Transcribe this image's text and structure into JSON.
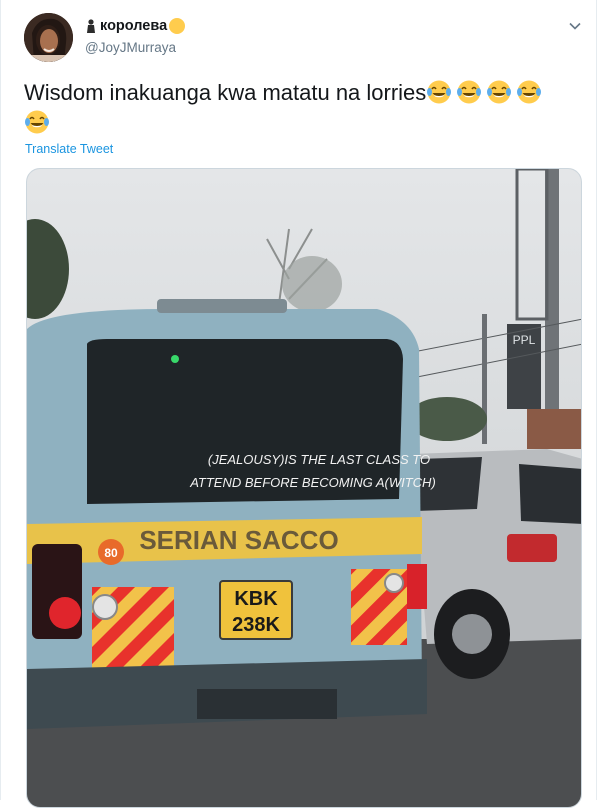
{
  "user": {
    "display_name": "королева",
    "handle": "@JoyJMurraya"
  },
  "tweet": {
    "text": "Wisdom inakuanga kwa matatu na lorries",
    "laugh_emoji_count": 5,
    "translate_label": "Translate Tweet"
  },
  "photo": {
    "van_window_line1": "(JEALOUSY)IS THE LAST  CLASS TO",
    "van_window_line2": "ATTEND BEFORE BECOMING A(WITCH)",
    "van_stripe_text": "SERIAN SACCO",
    "plate_line1": "KBK",
    "plate_line2": "238K",
    "speed_badge": "80",
    "billboard_text": "PPL"
  },
  "icons": {
    "menu": "chevron-down-icon",
    "crown": "crown-icon",
    "laugh": "face-with-tears-of-joy-icon"
  },
  "colors": {
    "link": "#1b95e0",
    "text": "#14171a",
    "muted": "#657786"
  }
}
